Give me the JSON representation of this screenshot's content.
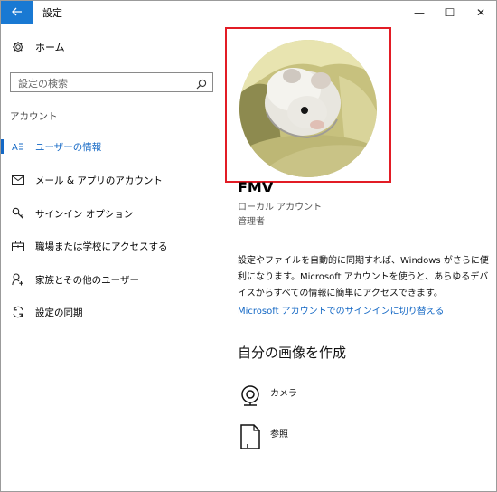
{
  "window": {
    "title": "設定",
    "back_icon": "back-arrow-icon",
    "minimize_label": "—",
    "maximize_label": "☐",
    "close_label": "✕",
    "accent_color": "#1979d3"
  },
  "sidebar": {
    "home_label": "ホーム",
    "search_placeholder": "設定の検索",
    "section_label": "アカウント",
    "items": [
      {
        "label": "ユーザーの情報",
        "icon": "user-info-icon",
        "active": true
      },
      {
        "label": "メール & アプリのアカウント",
        "icon": "mail-icon",
        "active": false
      },
      {
        "label": "サインイン オプション",
        "icon": "key-icon",
        "active": false
      },
      {
        "label": "職場または学校にアクセスする",
        "icon": "briefcase-icon",
        "active": false
      },
      {
        "label": "家族とその他のユーザー",
        "icon": "add-user-icon",
        "active": false
      },
      {
        "label": "設定の同期",
        "icon": "sync-icon",
        "active": false
      }
    ]
  },
  "main": {
    "user_name": "FMV",
    "account_type": "ローカル アカウント",
    "account_role": "管理者",
    "description": "設定やファイルを自動的に同期すれば、Windows がさらに便利になります。Microsoft アカウントを使うと、あらゆるデバイスからすべての情報に簡単にアクセスできます。",
    "switch_link": "Microsoft アカウントでのサインインに切り替える",
    "create_heading": "自分の画像を作成",
    "options": [
      {
        "label": "カメラ",
        "icon": "camera-icon"
      },
      {
        "label": "参照",
        "icon": "browse-file-icon"
      }
    ],
    "highlight_color": "#e21c25"
  }
}
